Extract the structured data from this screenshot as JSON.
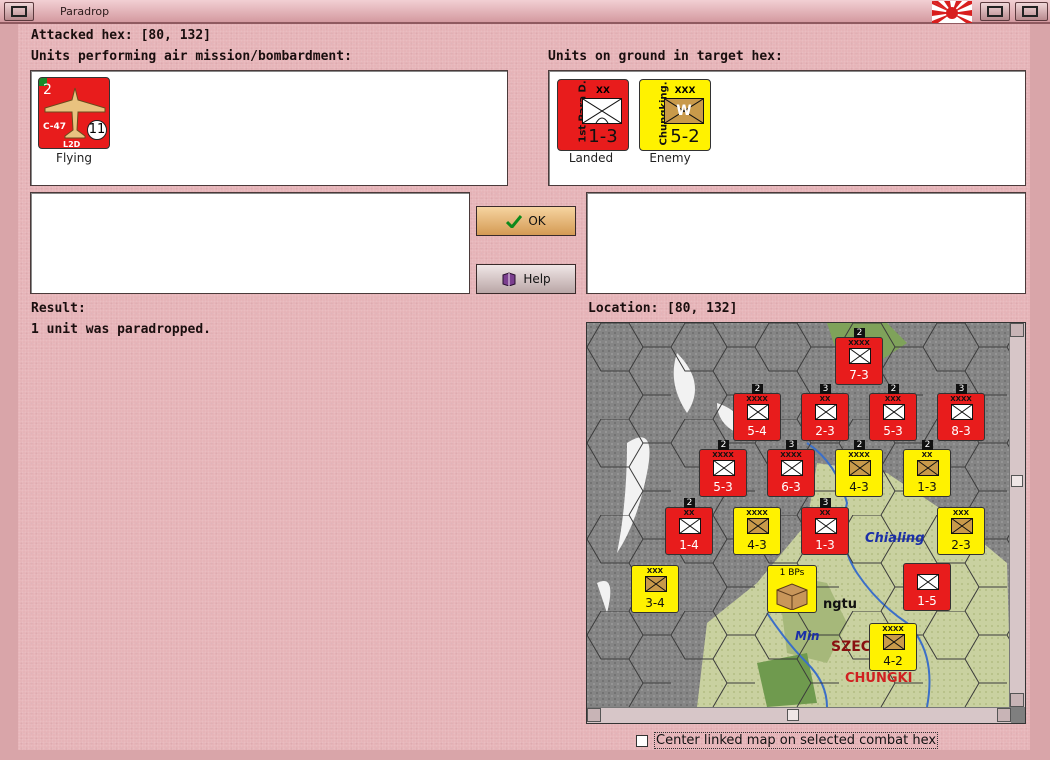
{
  "window": {
    "title": "Paradrop"
  },
  "header": {
    "attacked_hex": "Attacked hex: [80, 132]"
  },
  "air_panel": {
    "label": "Units performing air mission/bombardment:",
    "units": [
      {
        "steps": "2",
        "type": "C-47",
        "value": "11",
        "code": "L2D",
        "status": "Flying",
        "color": "#e81c1c"
      }
    ]
  },
  "ground_panel": {
    "label": "Units on ground in target hex:",
    "units": [
      {
        "name": "1st Para D.",
        "size": "XX",
        "strength": "1-3",
        "status": "Landed",
        "color": "#e81c1c"
      },
      {
        "name": "Chungking.",
        "size": "XXX",
        "symbol": "W",
        "strength": "5-2",
        "status": "Enemy",
        "color": "#fff200"
      }
    ]
  },
  "buttons": {
    "ok": "OK",
    "help": "Help"
  },
  "result": {
    "label": "Result:",
    "text": "1 unit was paradropped."
  },
  "location": {
    "label": "Location:",
    "value": "[80, 132]"
  },
  "map": {
    "labels": {
      "river1": "Chialing",
      "city": "ngtu",
      "river2": "Min",
      "region": "SZEC",
      "region2": "CHUNGKI"
    },
    "units": [
      {
        "c": "r",
        "s": "XXXX",
        "v": "7-3",
        "n": "2"
      },
      {
        "c": "r",
        "s": "XXXX",
        "v": "5-4",
        "n": "2"
      },
      {
        "c": "r",
        "s": "XX",
        "v": "2-3",
        "n": "3"
      },
      {
        "c": "r",
        "s": "XXX",
        "v": "5-3",
        "n": "2"
      },
      {
        "c": "r",
        "s": "XXXX",
        "v": "8-3",
        "n": "3"
      },
      {
        "c": "r",
        "s": "XXXX",
        "v": "5-3",
        "n": "2"
      },
      {
        "c": "r",
        "s": "XXXX",
        "v": "6-3",
        "n": "3"
      },
      {
        "c": "y",
        "s": "XXXX",
        "v": "4-3",
        "n": "2"
      },
      {
        "c": "y",
        "s": "XX",
        "v": "1-3",
        "n": "2"
      },
      {
        "c": "r",
        "s": "XX",
        "v": "1-4",
        "n": "2"
      },
      {
        "c": "y",
        "s": "XXXX",
        "v": "4-3",
        "n": ""
      },
      {
        "c": "r",
        "s": "XX",
        "v": "1-3",
        "n": "3"
      },
      {
        "c": "y",
        "s": "XXX",
        "v": "2-3",
        "n": ""
      },
      {
        "c": "y",
        "s": "XXX",
        "v": "3-4",
        "n": ""
      },
      {
        "c": "r",
        "s": "",
        "v": "1-5",
        "n": ""
      },
      {
        "c": "y",
        "s": "XXXX",
        "v": "4-2",
        "n": ""
      }
    ],
    "supply": "1 BPs"
  },
  "options": {
    "center_map": "Center linked map on selected combat hex"
  }
}
